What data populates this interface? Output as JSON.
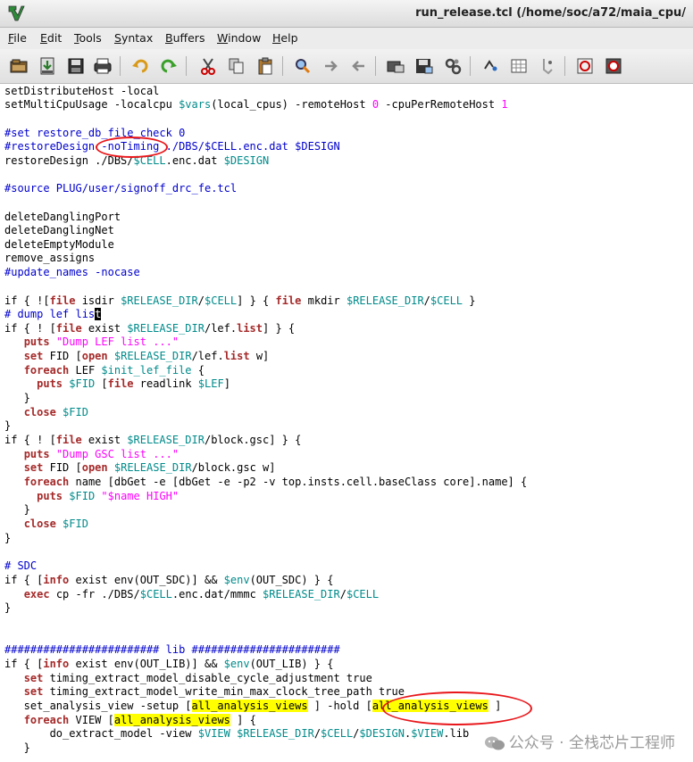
{
  "window": {
    "title": "run_release.tcl (/home/soc/a72/maia_cpu/"
  },
  "menu": [
    {
      "label": "File",
      "accel": "F",
      "rest": "ile"
    },
    {
      "label": "Edit",
      "accel": "E",
      "rest": "dit"
    },
    {
      "label": "Tools",
      "accel": "T",
      "rest": "ools"
    },
    {
      "label": "Syntax",
      "accel": "S",
      "rest": "yntax"
    },
    {
      "label": "Buffers",
      "accel": "B",
      "rest": "uffers"
    },
    {
      "label": "Window",
      "accel": "W",
      "rest": "indow"
    },
    {
      "label": "Help",
      "accel": "H",
      "rest": "elp"
    }
  ],
  "toolbar_icons": [
    "open-icon",
    "save-icon",
    "save-all-icon",
    "print-icon",
    "undo-icon",
    "redo-icon",
    "cut-icon",
    "copy-icon",
    "paste-icon",
    "find-replace-icon",
    "find-next-icon",
    "find-prev-icon",
    "load-session-icon",
    "save-session-icon",
    "run-script-icon",
    "make-icon",
    "shell-icon",
    "ctags-icon",
    "help-icon",
    "find-help-icon"
  ],
  "code": {
    "l1": "setDistributeHost -local",
    "l2a": "setMultiCpuUsage -localcpu ",
    "l2b": "$vars",
    "l2c": "(local_cpus) -remoteHost ",
    "l2d": "0",
    "l2e": " -cpuPerRemoteHost ",
    "l2f": "1",
    "l4": "#set restore_db_file_check 0",
    "l5a": "#restoreDesign ",
    "l5b": "-noTiming",
    "l5c": " ./DBS/",
    "l5d": "$CELL",
    "l5e": ".enc.dat ",
    "l5f": "$DESIGN",
    "l6a": "restoreDesign ./DBS/",
    "l6b": "$CELL",
    "l6c": ".enc.dat ",
    "l6d": "$DESIGN",
    "l8": "#source PLUG/user/signoff_drc_fe.tcl",
    "l10": "deleteDanglingPort",
    "l11": "deleteDanglingNet",
    "l12": "deleteEmptyModule",
    "l13": "remove_assigns",
    "l14": "#update_names -nocase",
    "l16a": "if { ![",
    "l16b": "file",
    "l16c": " isdir ",
    "l16d": "$RELEASE_DIR",
    "l16e": "/",
    "l16f": "$CELL",
    "l16g": "] } { ",
    "l16h": "file",
    "l16i": " mkdir ",
    "l16j": "$RELEASE_DIR",
    "l16k": "/",
    "l16l": "$CELL",
    "l16m": " }",
    "l17a": "# dump lef lis",
    "l17b": "t",
    "l18a": "if { ! [",
    "l18b": "file",
    "l18c": " exist ",
    "l18d": "$RELEASE_DIR",
    "l18e": "/lef.",
    "l18f": "list",
    "l18g": "] } {",
    "l19a": "   ",
    "l19b": "puts",
    "l19c": " ",
    "l19d": "\"Dump LEF list ...\"",
    "l20a": "   ",
    "l20b": "set",
    "l20c": " FID [",
    "l20d": "open",
    "l20e": " ",
    "l20f": "$RELEASE_DIR",
    "l20g": "/lef.",
    "l20h": "list",
    "l20i": " w]",
    "l21a": "   ",
    "l21b": "foreach",
    "l21c": " LEF ",
    "l21d": "$init_lef_file",
    "l21e": " {",
    "l22a": "     ",
    "l22b": "puts",
    "l22c": " ",
    "l22d": "$FID",
    "l22e": " [",
    "l22f": "file",
    "l22g": " readlink ",
    "l22h": "$LEF",
    "l22i": "]",
    "l23": "   }",
    "l24a": "   ",
    "l24b": "close",
    "l24c": " ",
    "l24d": "$FID",
    "l25": "}",
    "l26a": "if { ! [",
    "l26b": "file",
    "l26c": " exist ",
    "l26d": "$RELEASE_DIR",
    "l26e": "/block.gsc] } {",
    "l27a": "   ",
    "l27b": "puts",
    "l27c": " ",
    "l27d": "\"Dump GSC list ...\"",
    "l28a": "   ",
    "l28b": "set",
    "l28c": " FID [",
    "l28d": "open",
    "l28e": " ",
    "l28f": "$RELEASE_DIR",
    "l28g": "/block.gsc w]",
    "l29a": "   ",
    "l29b": "foreach",
    "l29c": " name [dbGet -e [dbGet -e -p2 -v top.insts.cell.baseClass core].name] {",
    "l30a": "     ",
    "l30b": "puts",
    "l30c": " ",
    "l30d": "$FID",
    "l30e": " ",
    "l30f": "\"$name HIGH\"",
    "l31": "   }",
    "l32a": "   ",
    "l32b": "close",
    "l32c": " ",
    "l32d": "$FID",
    "l33": "}",
    "l35": "# SDC",
    "l36a": "if { [",
    "l36b": "info",
    "l36c": " exist env(OUT_SDC)] && ",
    "l36d": "$env",
    "l36e": "(OUT_SDC) } {",
    "l37a": "   ",
    "l37b": "exec",
    "l37c": " cp -fr ./DBS/",
    "l37d": "$CELL",
    "l37e": ".enc.dat/mmmc ",
    "l37f": "$RELEASE_DIR",
    "l37g": "/",
    "l37h": "$CELL",
    "l38": "}",
    "l41": "######################## lib #######################",
    "l42a": "if { [",
    "l42b": "info",
    "l42c": " exist env(OUT_LIB)] && ",
    "l42d": "$env",
    "l42e": "(OUT_LIB) } {",
    "l43a": "   ",
    "l43b": "set",
    "l43c": " timing_extract_model_disable_cycle_adjustment true",
    "l44a": "   ",
    "l44b": "set",
    "l44c": " timing_extract_model_write_min_max_clock_tree_path true",
    "l45a": "   set_analysis_view -setup [",
    "l45b": "all_analysis_views",
    "l45c": " ] -hold [",
    "l45d": "all_analysis_views",
    "l45e": " ]",
    "l46a": "   ",
    "l46b": "foreach",
    "l46c": " VIEW [",
    "l46d": "all_analysis_views",
    "l46e": " ] {",
    "l47a": "       do_extract_model -view ",
    "l47b": "$VIEW",
    "l47c": " ",
    "l47d": "$RELEASE_DIR",
    "l47e": "/",
    "l47f": "$CELL",
    "l47g": "/",
    "l47h": "$DESIGN",
    "l47i": ".",
    "l47j": "$VIEW",
    "l47k": ".lib",
    "l48": "   }"
  },
  "watermark": {
    "text": "公众号 · 全栈芯片工程师"
  },
  "colors": {
    "keyword": "#a52a2a",
    "variable": "#008b8b",
    "string": "#ff00ff",
    "comment": "#0000cd",
    "highlight": "#ffff00",
    "annotation": "#e8161a"
  }
}
